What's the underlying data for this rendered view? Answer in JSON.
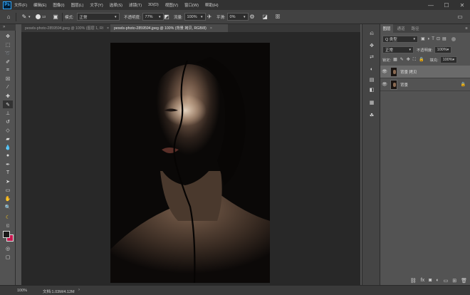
{
  "app": {
    "logo_text": "Ps",
    "menu": [
      "文件(F)",
      "编辑(E)",
      "图像(I)",
      "图层(L)",
      "文字(Y)",
      "选择(S)",
      "滤镜(T)",
      "3D(D)",
      "视图(V)",
      "窗口(W)",
      "帮助(H)"
    ],
    "window_controls": [
      "—",
      "☐",
      "✕"
    ]
  },
  "options_bar": {
    "brush_size": "13",
    "mode_label": "模式:",
    "mode_value": "正常",
    "opacity_label": "不透明度:",
    "opacity_value": "77%",
    "flow_label": "流量:",
    "flow_value": "100%",
    "smooth_label": "平滑:",
    "smooth_value": "0%"
  },
  "tabs": [
    {
      "label": "pexels-photo-2859594.jpeg @ 100% (图层 1, RGB/8) *",
      "active": false
    },
    {
      "label": "pexels-photo-2859594.jpeg @ 100% (背景 拷贝, RGB/8)",
      "active": true
    }
  ],
  "status": {
    "zoom": "100%",
    "doc_info": "文档:1.03M/4.12M"
  },
  "panels": {
    "tabs": [
      "图层",
      "通道",
      "路径"
    ],
    "filter_kind": "Q 类型",
    "blend_mode": "正常",
    "opacity_label": "不透明度:",
    "opacity_value": "100%",
    "lock_label": "锁定:",
    "fill_label": "填充:",
    "fill_value": "100%"
  },
  "layers": [
    {
      "name": "背景 拷贝",
      "selected": true,
      "locked": false
    },
    {
      "name": "背景",
      "selected": false,
      "locked": true
    }
  ],
  "colors": {
    "foreground": "#1a1a1a",
    "background": "#c8174f",
    "accent": "#31a8ff"
  }
}
